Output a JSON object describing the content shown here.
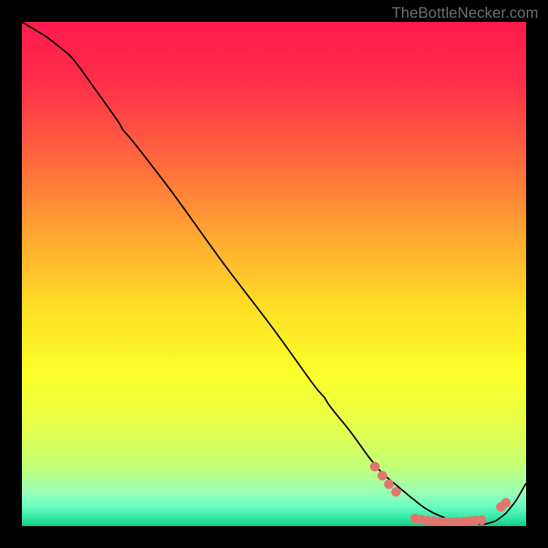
{
  "watermark": "TheBottleNecker.com",
  "gradient_stops": [
    {
      "pct": 0,
      "color": "#ff1a4c"
    },
    {
      "pct": 12,
      "color": "#ff2e4a"
    },
    {
      "pct": 28,
      "color": "#ff6a3c"
    },
    {
      "pct": 45,
      "color": "#ffb22e"
    },
    {
      "pct": 58,
      "color": "#ffe325"
    },
    {
      "pct": 70,
      "color": "#fbff2a"
    },
    {
      "pct": 80,
      "color": "#e7ff4a"
    },
    {
      "pct": 88,
      "color": "#c4ff74"
    },
    {
      "pct": 93,
      "color": "#9dffb3"
    },
    {
      "pct": 96,
      "color": "#6cfcc2"
    },
    {
      "pct": 98.5,
      "color": "#2fe8a6"
    },
    {
      "pct": 100,
      "color": "#19c97f"
    }
  ],
  "chart_data": {
    "type": "line",
    "title": "",
    "xlabel": "",
    "ylabel": "",
    "x": [
      0.0,
      0.05,
      0.1,
      0.15,
      0.2,
      0.3,
      0.4,
      0.5,
      0.6,
      0.65,
      0.7,
      0.72,
      0.75,
      0.78,
      0.8,
      0.82,
      0.84,
      0.86,
      0.88,
      0.9,
      0.92,
      0.94,
      0.96,
      0.98,
      1.0
    ],
    "series": [
      {
        "name": "curve",
        "values": [
          1.0,
          0.97,
          0.93,
          0.86,
          0.79,
          0.66,
          0.52,
          0.39,
          0.25,
          0.19,
          0.12,
          0.1,
          0.075,
          0.05,
          0.035,
          0.024,
          0.016,
          0.01,
          0.006,
          0.004,
          0.004,
          0.01,
          0.025,
          0.05,
          0.085
        ]
      }
    ],
    "markers": {
      "color": "#e0766e",
      "radius": 7,
      "points": [
        {
          "x": 0.7,
          "y": 0.118
        },
        {
          "x": 0.715,
          "y": 0.1
        },
        {
          "x": 0.728,
          "y": 0.083
        },
        {
          "x": 0.742,
          "y": 0.068
        },
        {
          "x": 0.78,
          "y": 0.015
        },
        {
          "x": 0.792,
          "y": 0.013
        },
        {
          "x": 0.804,
          "y": 0.011
        },
        {
          "x": 0.816,
          "y": 0.01
        },
        {
          "x": 0.828,
          "y": 0.009
        },
        {
          "x": 0.84,
          "y": 0.008
        },
        {
          "x": 0.852,
          "y": 0.008
        },
        {
          "x": 0.864,
          "y": 0.008
        },
        {
          "x": 0.876,
          "y": 0.009
        },
        {
          "x": 0.888,
          "y": 0.01
        },
        {
          "x": 0.9,
          "y": 0.011
        },
        {
          "x": 0.912,
          "y": 0.012
        },
        {
          "x": 0.95,
          "y": 0.038
        },
        {
          "x": 0.96,
          "y": 0.046
        }
      ]
    },
    "xlim": [
      0,
      1
    ],
    "ylim": [
      0,
      1
    ]
  }
}
